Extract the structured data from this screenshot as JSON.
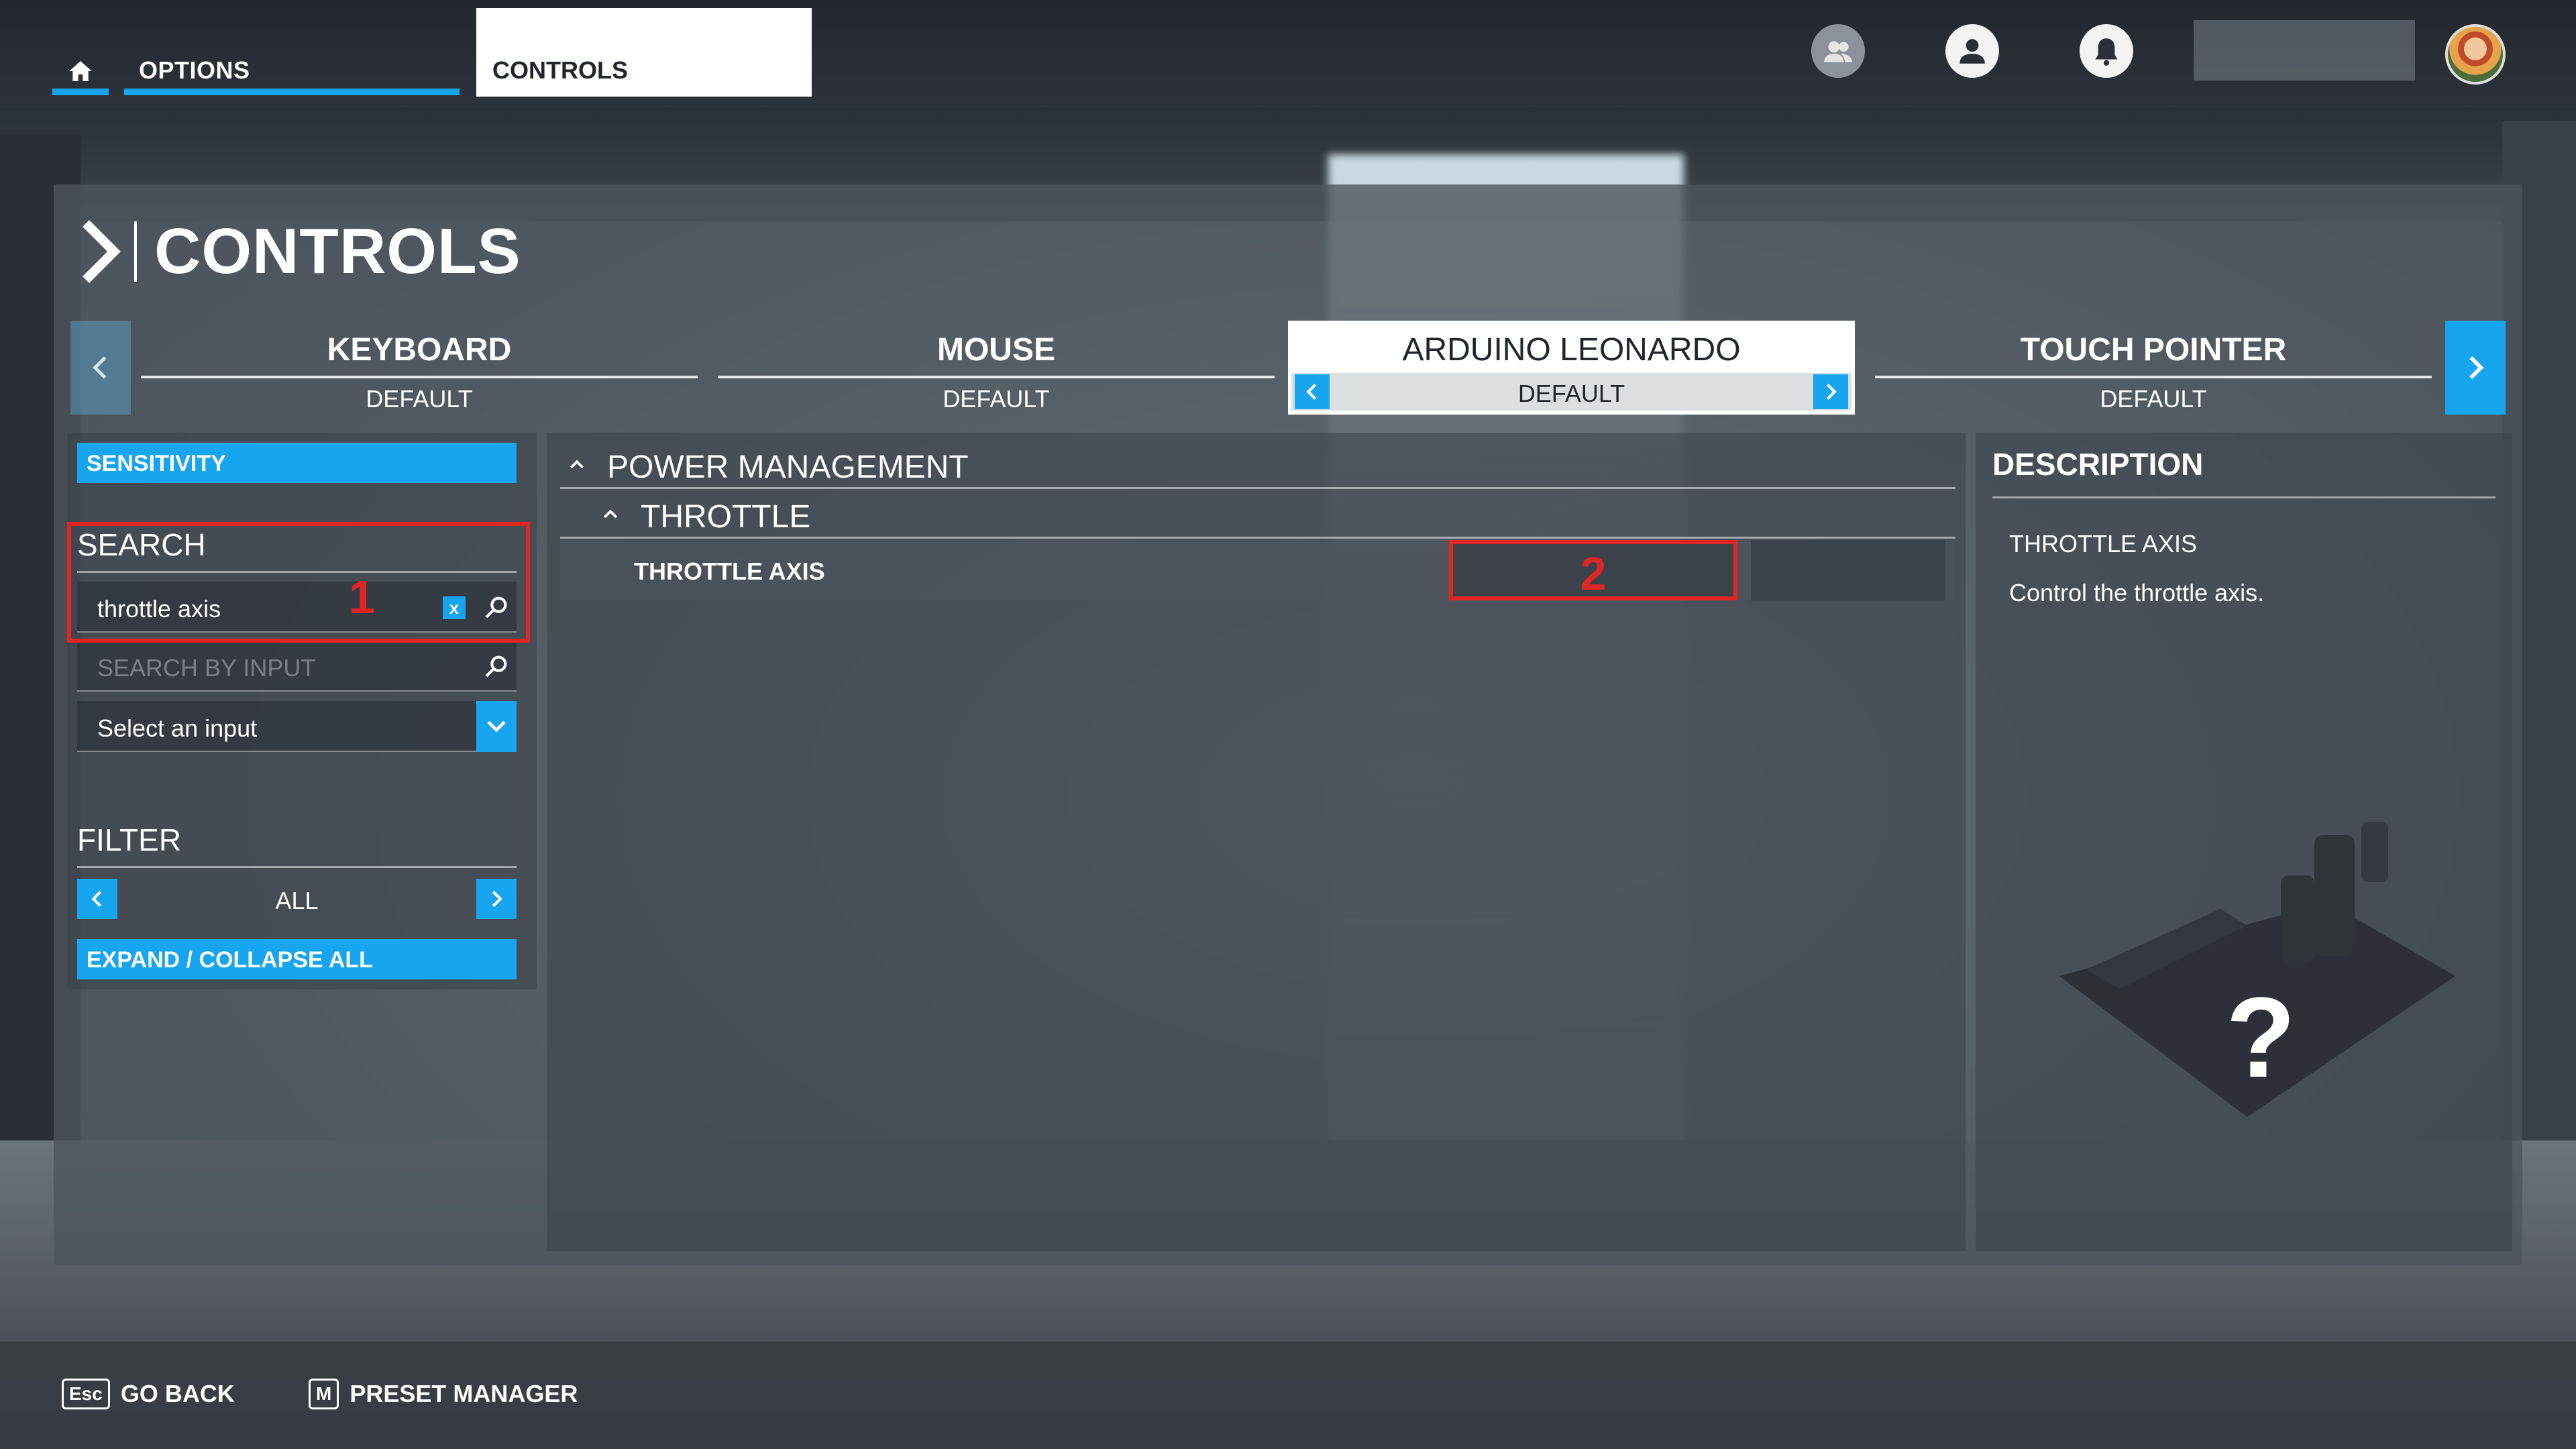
{
  "topbar": {
    "tabs": [
      {
        "label": "OPTIONS"
      },
      {
        "label": "CONTROLS"
      }
    ]
  },
  "panel": {
    "title": "CONTROLS"
  },
  "devices": [
    {
      "name": "KEYBOARD",
      "preset": "DEFAULT"
    },
    {
      "name": "MOUSE",
      "preset": "DEFAULT"
    },
    {
      "name": "ARDUINO LEONARDO",
      "preset": "DEFAULT",
      "active": true
    },
    {
      "name": "TOUCH POINTER",
      "preset": "DEFAULT"
    }
  ],
  "left": {
    "sensitivity_label": "SENSITIVITY",
    "search_heading": "SEARCH",
    "search_value": "throttle axis",
    "search_clear": "x",
    "search_by_input_placeholder": "SEARCH BY INPUT",
    "select_input_label": "Select an input",
    "filter_heading": "FILTER",
    "filter_value": "ALL",
    "expand_collapse_label": "EXPAND / COLLAPSE ALL",
    "annotation_1": "1"
  },
  "list": {
    "group": "POWER MANAGEMENT",
    "subgroup": "THROTTLE",
    "binding_label": "THROTTLE AXIS",
    "annotation_2": "2"
  },
  "description": {
    "heading": "DESCRIPTION",
    "item": "THROTTLE AXIS",
    "text": "Control the throttle axis.",
    "unknown_symbol": "?"
  },
  "bottom": {
    "go_back_key": "Esc",
    "go_back_label": "GO BACK",
    "preset_key": "M",
    "preset_label": "PRESET MANAGER"
  },
  "colors": {
    "accent": "#16a5ee",
    "annotation": "#e02525"
  }
}
